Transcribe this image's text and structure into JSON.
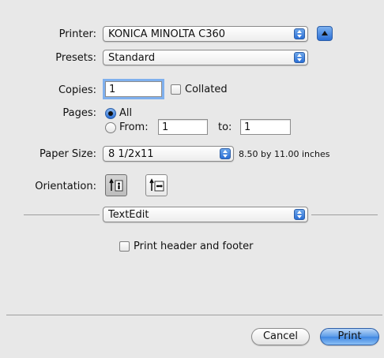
{
  "printer": {
    "label": "Printer:",
    "value": "KONICA MINOLTA C360"
  },
  "presets": {
    "label": "Presets:",
    "value": "Standard"
  },
  "copies": {
    "label": "Copies:",
    "value": "1",
    "collated_label": "Collated",
    "collated": false
  },
  "pages": {
    "label": "Pages:",
    "all_label": "All",
    "all_selected": true,
    "from_label": "From:",
    "from_value": "1",
    "to_label": "to:",
    "to_value": "1"
  },
  "paper_size": {
    "label": "Paper Size:",
    "value": "8 1/2x11",
    "dimensions": "8.50 by 11.00 inches"
  },
  "orientation": {
    "label": "Orientation:",
    "options": [
      "portrait",
      "landscape"
    ],
    "selected": "portrait"
  },
  "section": {
    "value": "TextEdit"
  },
  "header_footer": {
    "label": "Print header and footer",
    "checked": false
  },
  "actions": {
    "cancel_label": "Cancel",
    "print_label": "Print"
  },
  "colors": {
    "accent": "#3f86e2",
    "background": "#e8e8e8"
  }
}
